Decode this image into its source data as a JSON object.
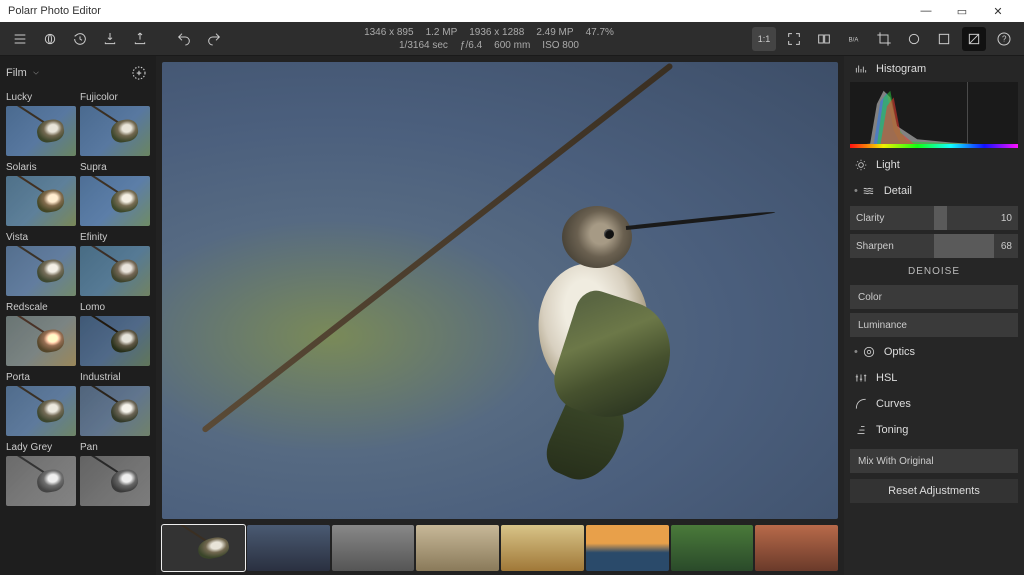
{
  "window": {
    "title": "Polarr Photo Editor"
  },
  "meta": {
    "row1": [
      "1346 x 895",
      "1.2 MP",
      "1936 x 1288",
      "2.49 MP",
      "47.7%"
    ],
    "row2": [
      "1/3164 sec",
      "ƒ/6.4",
      "600 mm",
      "ISO 800"
    ]
  },
  "right_tools": {
    "one_to_one": "1:1"
  },
  "filter_category": "Film",
  "filters": [
    {
      "name": "Lucky"
    },
    {
      "name": "Fujicolor"
    },
    {
      "name": "Solaris"
    },
    {
      "name": "Supra"
    },
    {
      "name": "Vista"
    },
    {
      "name": "Efinity"
    },
    {
      "name": "Redscale"
    },
    {
      "name": "Lomo"
    },
    {
      "name": "Porta"
    },
    {
      "name": "Industrial"
    },
    {
      "name": "Lady Grey"
    },
    {
      "name": "Pan"
    }
  ],
  "panels": {
    "histogram": "Histogram",
    "light": "Light",
    "detail": "Detail",
    "optics": "Optics",
    "hsl": "HSL",
    "curves": "Curves",
    "toning": "Toning"
  },
  "detail": {
    "clarity": {
      "label": "Clarity",
      "value": 10
    },
    "sharpen": {
      "label": "Sharpen",
      "value": 68
    },
    "denoise_title": "DENOISE",
    "denoise_color": "Color",
    "denoise_luminance": "Luminance"
  },
  "actions": {
    "mix": "Mix With Original",
    "reset": "Reset Adjustments"
  }
}
